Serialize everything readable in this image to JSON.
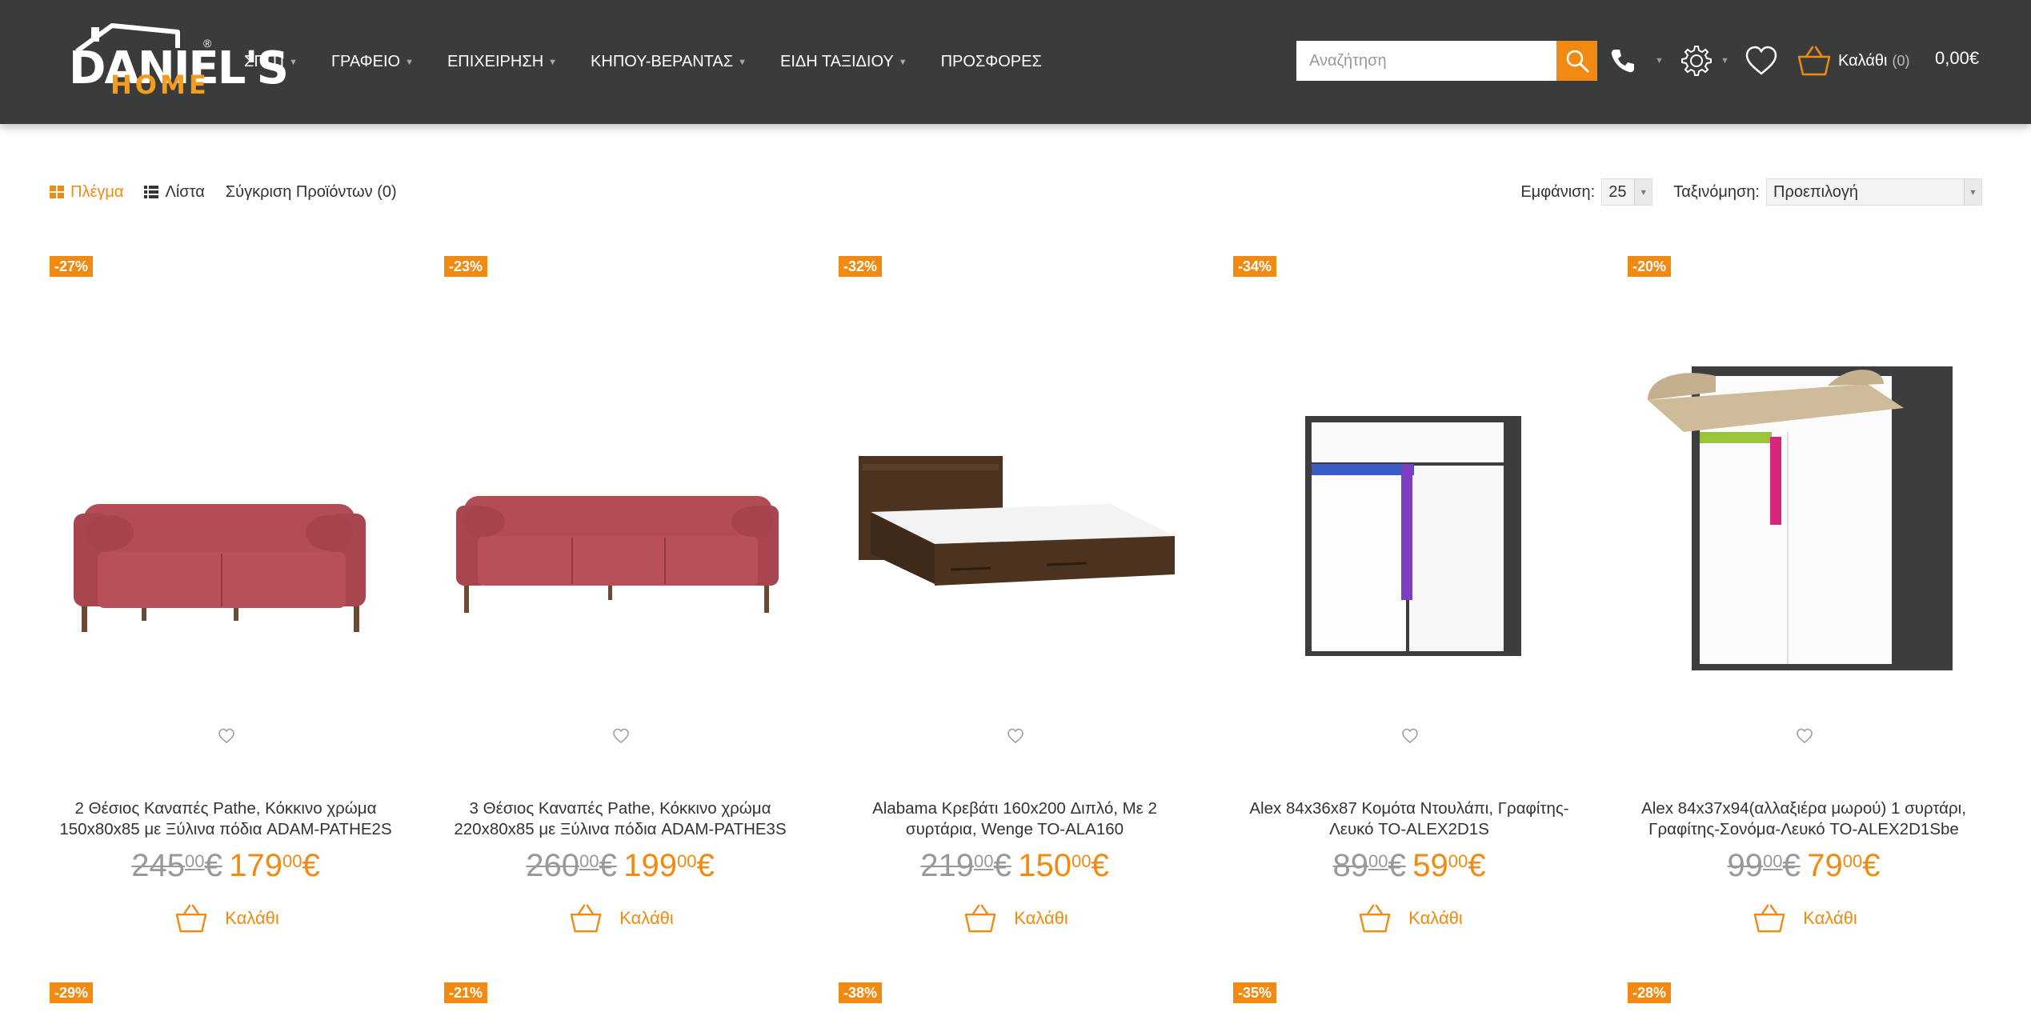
{
  "brand": {
    "line1": "DANIEL'S",
    "line2": "HOME",
    "reg": "®",
    "accent": "#f08a12",
    "header_bg": "#3a3c3b"
  },
  "nav": [
    {
      "label": "ΣΠΙΤΙ",
      "dropdown": true
    },
    {
      "label": "ΓΡΑΦΕΙΟ",
      "dropdown": true
    },
    {
      "label": "ΕΠΙΧΕΙΡΗΣΗ",
      "dropdown": true
    },
    {
      "label": "ΚΗΠΟΥ-ΒΕΡΑΝΤΑΣ",
      "dropdown": true
    },
    {
      "label": "ΕΙΔΗ ΤΑΞΙΔΙΟΥ",
      "dropdown": true
    },
    {
      "label": "ΠΡΟΣΦΟΡΕΣ",
      "dropdown": false
    }
  ],
  "search": {
    "placeholder": "Αναζήτηση"
  },
  "cart": {
    "label": "Καλάθι",
    "count": "(0)",
    "total": "0,00€"
  },
  "toolbar": {
    "grid": "Πλέγμα",
    "list": "Λίστα",
    "compare": "Σύγκριση Προϊόντων (0)",
    "show_label": "Εμφάνιση:",
    "show_value": "25",
    "sort_label": "Ταξινόμηση:",
    "sort_value": "Προεπιλογή"
  },
  "products": [
    {
      "badge": "-27%",
      "title": "2 Θέσιος Καναπές Pathe, Κόκκινο χρώμα 150x80x85 με Ξύλινα πόδια ADAM-PATHE2S",
      "old_int": "245",
      "old_dec": "00",
      "new_int": "179",
      "new_dec": "00",
      "cart": "Καλάθι",
      "image": "sofa-2-seat-red"
    },
    {
      "badge": "-23%",
      "title": "3 Θέσιος Καναπές Pathe, Κόκκινο χρώμα 220x80x85 με Ξύλινα πόδια ADAM-PATHE3S",
      "old_int": "260",
      "old_dec": "00",
      "new_int": "199",
      "new_dec": "00",
      "cart": "Καλάθι",
      "image": "sofa-3-seat-red"
    },
    {
      "badge": "-32%",
      "title": "Alabama Κρεβάτι 160x200 Διπλό, Με 2 συρτάρια, Wenge TO-ALA160",
      "old_int": "219",
      "old_dec": "00",
      "new_int": "150",
      "new_dec": "00",
      "cart": "Καλάθι",
      "image": "bed-wenge"
    },
    {
      "badge": "-34%",
      "title": "Alex 84x36x87 Κομότα Ντουλάπι, Γραφίτης-Λευκό TO-ALEX2D1S",
      "old_int": "89",
      "old_dec": "00",
      "new_int": "59",
      "new_dec": "00",
      "cart": "Καλάθι",
      "image": "cabinet-graphite-white"
    },
    {
      "badge": "-20%",
      "title": "Alex 84x37x94(αλλαξιέρα μωρού) 1 συρτάρι, Γραφίτης-Σονόμα-Λευκό TO-ALEX2D1Sbe",
      "old_int": "99",
      "old_dec": "00",
      "new_int": "79",
      "new_dec": "00",
      "cart": "Καλάθι",
      "image": "changing-table"
    }
  ],
  "next_row_badges": [
    "-29%",
    "-21%",
    "-38%",
    "-35%",
    "-28%"
  ]
}
